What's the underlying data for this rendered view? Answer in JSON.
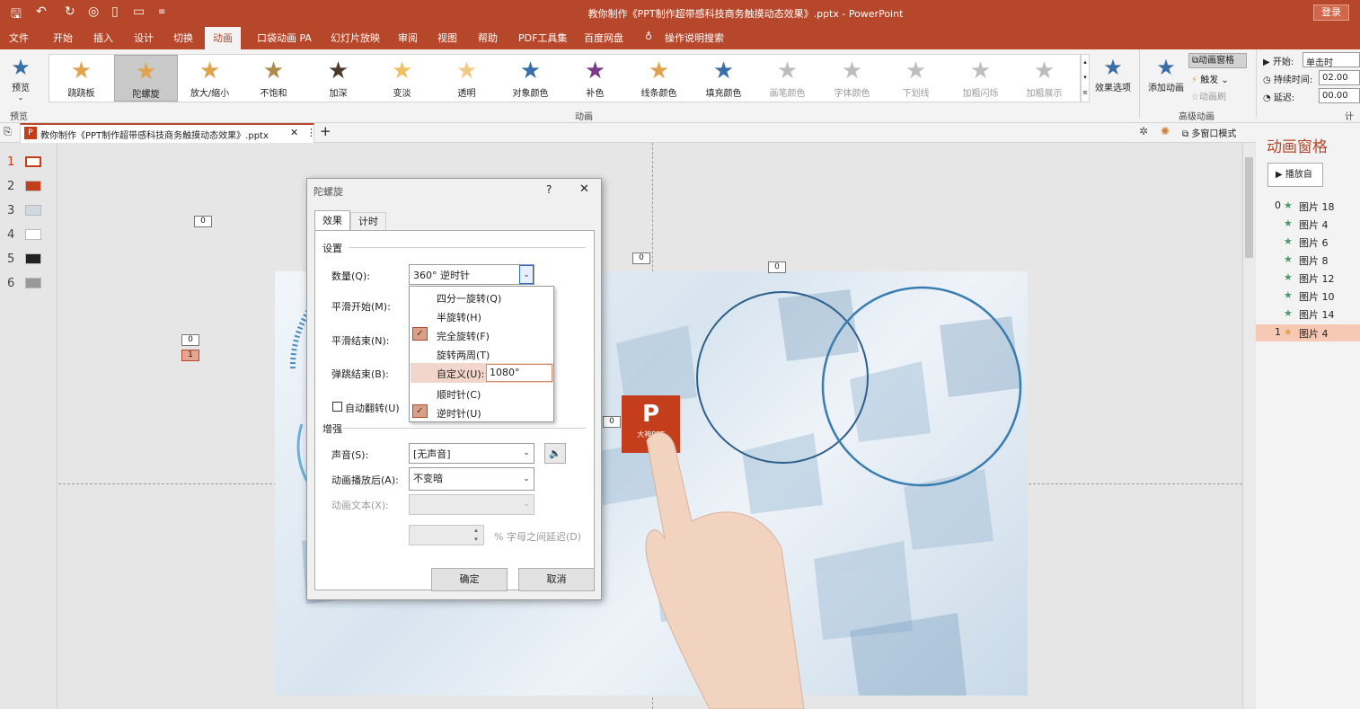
{
  "app": {
    "title": "教你制作《PPT制作超带感科技商务触摸动态效果》.pptx  -  PowerPoint",
    "login": "登录"
  },
  "colors": {
    "accent": "#b7472a",
    "selected_option": "#f3d6cb",
    "star_gold": "#e0a24a",
    "star_blue": "#3a6ea8"
  },
  "menu": [
    "文件",
    "开始",
    "插入",
    "设计",
    "切换",
    "动画",
    "口袋动画 PA",
    "幻灯片放映",
    "审阅",
    "视图",
    "帮助",
    "PDF工具集",
    "百度网盘",
    "操作说明搜索"
  ],
  "ribbon": {
    "preview": "预览",
    "preview_group": "预览",
    "effects": [
      {
        "label": "跷跷板"
      },
      {
        "label": "陀螺旋"
      },
      {
        "label": "放大/缩小"
      },
      {
        "label": "不饱和"
      },
      {
        "label": "加深"
      },
      {
        "label": "变淡"
      },
      {
        "label": "透明"
      },
      {
        "label": "对象颜色"
      },
      {
        "label": "补色"
      },
      {
        "label": "线条颜色"
      },
      {
        "label": "填充颜色"
      },
      {
        "label": "画笔颜色"
      },
      {
        "label": "字体颜色"
      },
      {
        "label": "下划线"
      },
      {
        "label": "加粗闪烁"
      },
      {
        "label": "加粗展示"
      }
    ],
    "effect_options": "效果选项",
    "animation_group": "动画",
    "add_animation": "添加动画",
    "animation_pane": "动画窗格",
    "trigger": "触发",
    "anim_painter": "动画刷",
    "advanced_group": "高级动画",
    "start_label": "开始:",
    "start_value": "单击时",
    "duration_label": "持续时间:",
    "duration_value": "02.00",
    "delay_label": "延迟:",
    "delay_value": "00.00",
    "timing_group": "计时"
  },
  "doc_tab": {
    "name": "教你制作《PPT制作超带感科技商务触摸动态效果》.pptx",
    "multiwindow": "多窗口模式"
  },
  "slides": [
    "1",
    "2",
    "3",
    "4",
    "5",
    "6"
  ],
  "canvas_tags": [
    "0",
    "0",
    "1",
    "0",
    "0",
    "0"
  ],
  "logo": {
    "letters": "P",
    "caption": "大神PPT"
  },
  "dialog": {
    "title": "陀螺旋",
    "help": "?",
    "tabs": [
      "效果",
      "计时"
    ],
    "settings_header": "设置",
    "amount_label": "数量(Q):",
    "amount_value": "360° 逆时针",
    "smooth_start": "平滑开始(M):",
    "smooth_end": "平滑结束(N):",
    "bounce_end": "弹跳结束(B):",
    "auto_reverse": "自动翻转(U)",
    "enhance_header": "增强",
    "sound_label": "声音(S):",
    "sound_value": "[无声音]",
    "after_label": "动画播放后(A):",
    "after_value": "不变暗",
    "text_label": "动画文本(X):",
    "delay_suffix": "% 字母之间延迟(D)",
    "ok": "确定",
    "cancel": "取消"
  },
  "dropdown": {
    "options": [
      "四分一旋转(Q)",
      "半旋转(H)",
      "完全旋转(F)",
      "旋转两周(T)",
      "自定义(U):",
      "顺时针(C)",
      "逆时针(U)"
    ],
    "custom_value": "1080°"
  },
  "anim_pane": {
    "title": "动画窗格",
    "play_button": "播放自",
    "items": [
      {
        "num": "0",
        "name": "图片 18"
      },
      {
        "num": "",
        "name": "图片 4"
      },
      {
        "num": "",
        "name": "图片 6"
      },
      {
        "num": "",
        "name": "图片 8"
      },
      {
        "num": "",
        "name": "图片 12"
      },
      {
        "num": "",
        "name": "图片 10"
      },
      {
        "num": "",
        "name": "图片 14"
      },
      {
        "num": "1",
        "name": "图片 4"
      }
    ]
  }
}
